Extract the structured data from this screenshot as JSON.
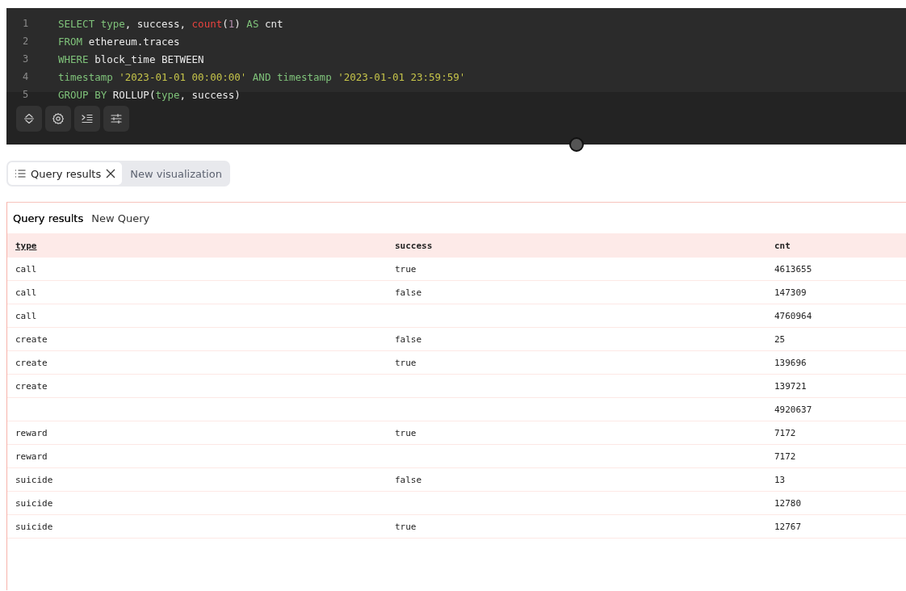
{
  "editor": {
    "lines": [
      {
        "number": "1",
        "tokens": [
          {
            "kind": "keyword",
            "text": "SELECT "
          },
          {
            "kind": "keyword",
            "text": "type"
          },
          {
            "kind": "plain",
            "text": ", success, "
          },
          {
            "kind": "function",
            "text": "count"
          },
          {
            "kind": "plain",
            "text": "("
          },
          {
            "kind": "number",
            "text": "1"
          },
          {
            "kind": "plain",
            "text": ") "
          },
          {
            "kind": "keyword",
            "text": "AS"
          },
          {
            "kind": "plain",
            "text": " cnt"
          }
        ]
      },
      {
        "number": "2",
        "tokens": [
          {
            "kind": "keyword",
            "text": "FROM"
          },
          {
            "kind": "plain",
            "text": " ethereum.traces"
          }
        ]
      },
      {
        "number": "3",
        "tokens": [
          {
            "kind": "keyword",
            "text": "WHERE"
          },
          {
            "kind": "plain",
            "text": " block_time BETWEEN"
          }
        ]
      },
      {
        "number": "4",
        "tokens": [
          {
            "kind": "keyword",
            "text": "timestamp "
          },
          {
            "kind": "string",
            "text": "'2023-01-01 00:00:00'"
          },
          {
            "kind": "keyword",
            "text": " AND timestamp "
          },
          {
            "kind": "string",
            "text": "'2023-01-01 23:59:59'"
          }
        ]
      },
      {
        "number": "5",
        "tokens": [
          {
            "kind": "keyword",
            "text": "GROUP BY"
          },
          {
            "kind": "plain",
            "text": " ROLLUP("
          },
          {
            "kind": "keyword",
            "text": "type"
          },
          {
            "kind": "plain",
            "text": ", success)"
          }
        ]
      }
    ],
    "toolbar": [
      {
        "kind": "expand"
      },
      {
        "kind": "settings"
      },
      {
        "kind": "indent"
      },
      {
        "kind": "sliders"
      }
    ]
  },
  "tabs": [
    {
      "label": "Query results",
      "selected": true,
      "closable": true
    },
    {
      "label": "New visualization",
      "selected": false,
      "closable": false
    }
  ],
  "results": {
    "tabs": [
      {
        "label": "Query results",
        "selected": true
      },
      {
        "label": "New Query",
        "selected": false
      }
    ],
    "columns": [
      {
        "label": "type",
        "sorted": true
      },
      {
        "label": "success",
        "sorted": false
      },
      {
        "label": "cnt",
        "sorted": false
      }
    ],
    "rows": [
      [
        "call",
        "true",
        "4613655"
      ],
      [
        "call",
        "false",
        "147309"
      ],
      [
        "call",
        "",
        "4760964"
      ],
      [
        "create",
        "false",
        "25"
      ],
      [
        "create",
        "true",
        "139696"
      ],
      [
        "create",
        "",
        "139721"
      ],
      [
        "",
        "",
        "4920637"
      ],
      [
        "reward",
        "true",
        "7172"
      ],
      [
        "reward",
        "",
        "7172"
      ],
      [
        "suicide",
        "false",
        "13"
      ],
      [
        "suicide",
        "",
        "12780"
      ],
      [
        "suicide",
        "true",
        "12767"
      ]
    ]
  }
}
